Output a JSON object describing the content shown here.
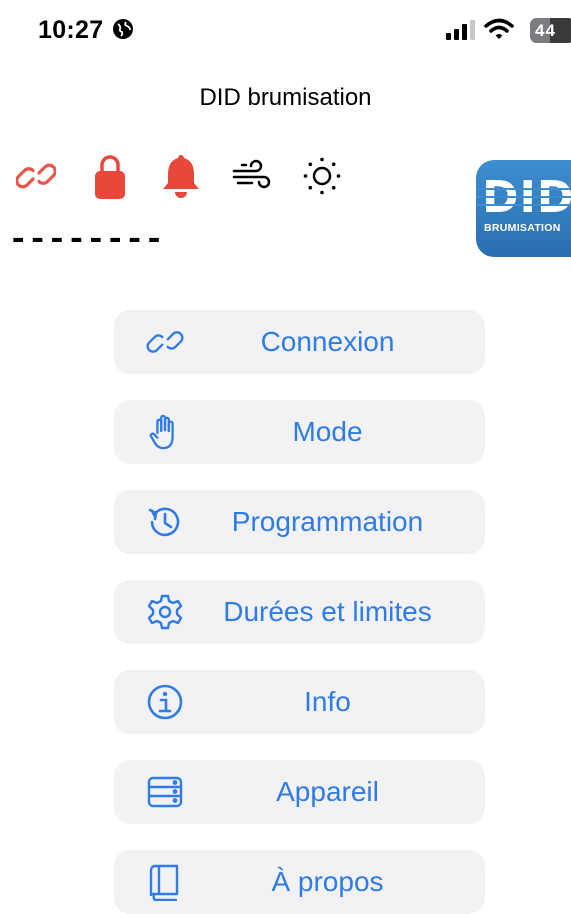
{
  "status_bar": {
    "time": "10:27",
    "battery": "44"
  },
  "nav": {
    "title": "DID brumisation"
  },
  "indicators": {
    "icons": [
      "link-icon",
      "lock-icon",
      "bell-icon",
      "wind-icon",
      "sun-icon"
    ],
    "colors": {
      "link": "#e8564a",
      "lock": "#e8473c",
      "bell": "#e8473c",
      "wind": "#000000",
      "sun": "#000000"
    }
  },
  "value_display": "--------",
  "logo": {
    "text": "DID",
    "subtitle": "BRUMISATION"
  },
  "accent_color": "#2f7be8",
  "menu": {
    "items": [
      {
        "label": "Connexion",
        "icon": "link-icon"
      },
      {
        "label": "Mode",
        "icon": "hand-icon"
      },
      {
        "label": "Programmation",
        "icon": "history-icon"
      },
      {
        "label": "Durées et limites",
        "icon": "gear-icon"
      },
      {
        "label": "Info",
        "icon": "info-icon"
      },
      {
        "label": "Appareil",
        "icon": "server-icon"
      },
      {
        "label": "À propos",
        "icon": "book-icon"
      }
    ]
  }
}
